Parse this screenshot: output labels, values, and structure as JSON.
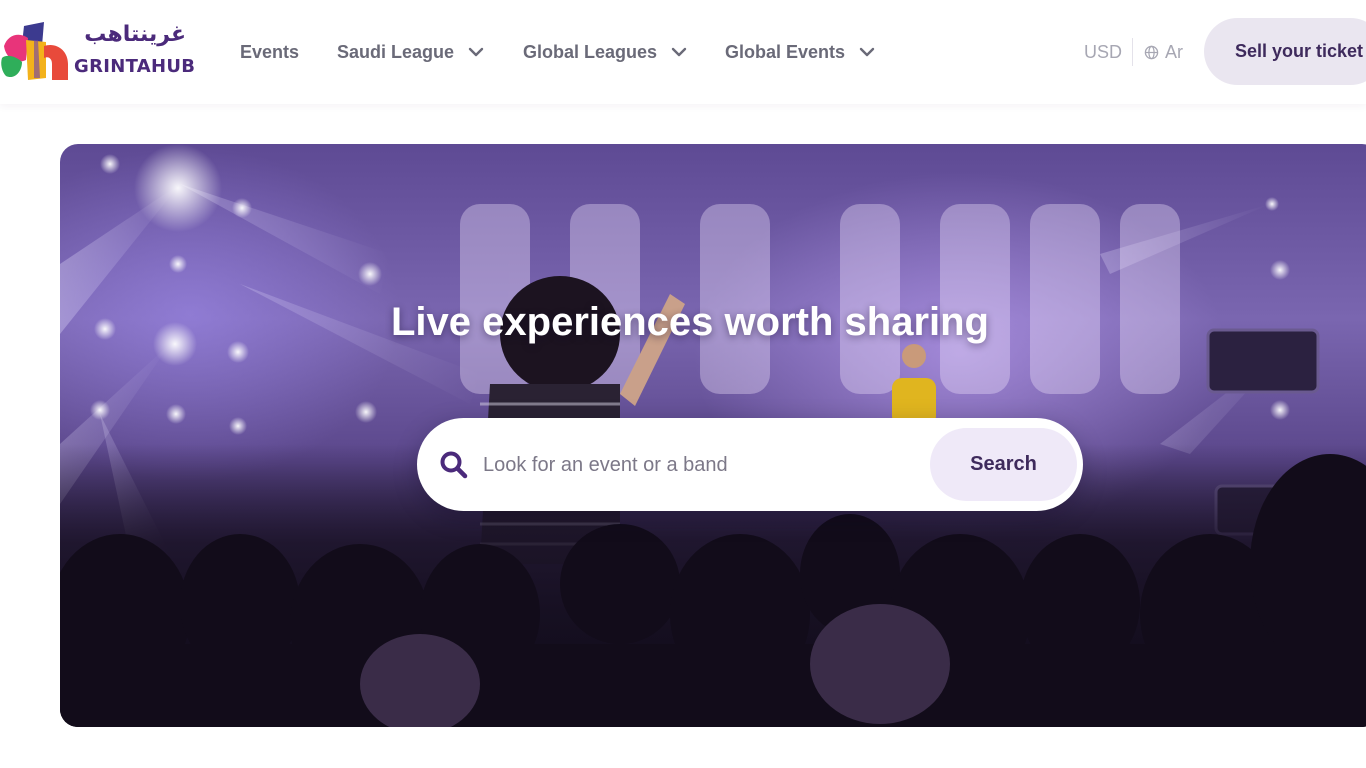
{
  "brand": {
    "name_arabic": "غرينتاهب",
    "name_latin": "GRINTAHUB",
    "logo_icon": "grintahub-logo-icon",
    "color_primary": "#4b2a7b"
  },
  "nav": {
    "items": [
      {
        "label": "Events",
        "has_dropdown": false
      },
      {
        "label": "Saudi League",
        "has_dropdown": true,
        "icon": "chevron-down-icon"
      },
      {
        "label": "Global Leagues",
        "has_dropdown": true,
        "icon": "chevron-down-icon"
      },
      {
        "label": "Global Events",
        "has_dropdown": true,
        "icon": "chevron-down-icon"
      }
    ],
    "currency": "USD",
    "language": {
      "label": "Ar",
      "icon": "globe-icon"
    },
    "sell_button": "Sell your ticket"
  },
  "hero": {
    "title": "Live experiences worth sharing",
    "background": "concert-crowd-stage-photo",
    "search": {
      "placeholder": "Look for an event or a band",
      "value": "",
      "icon": "search-icon",
      "button_label": "Search"
    }
  }
}
